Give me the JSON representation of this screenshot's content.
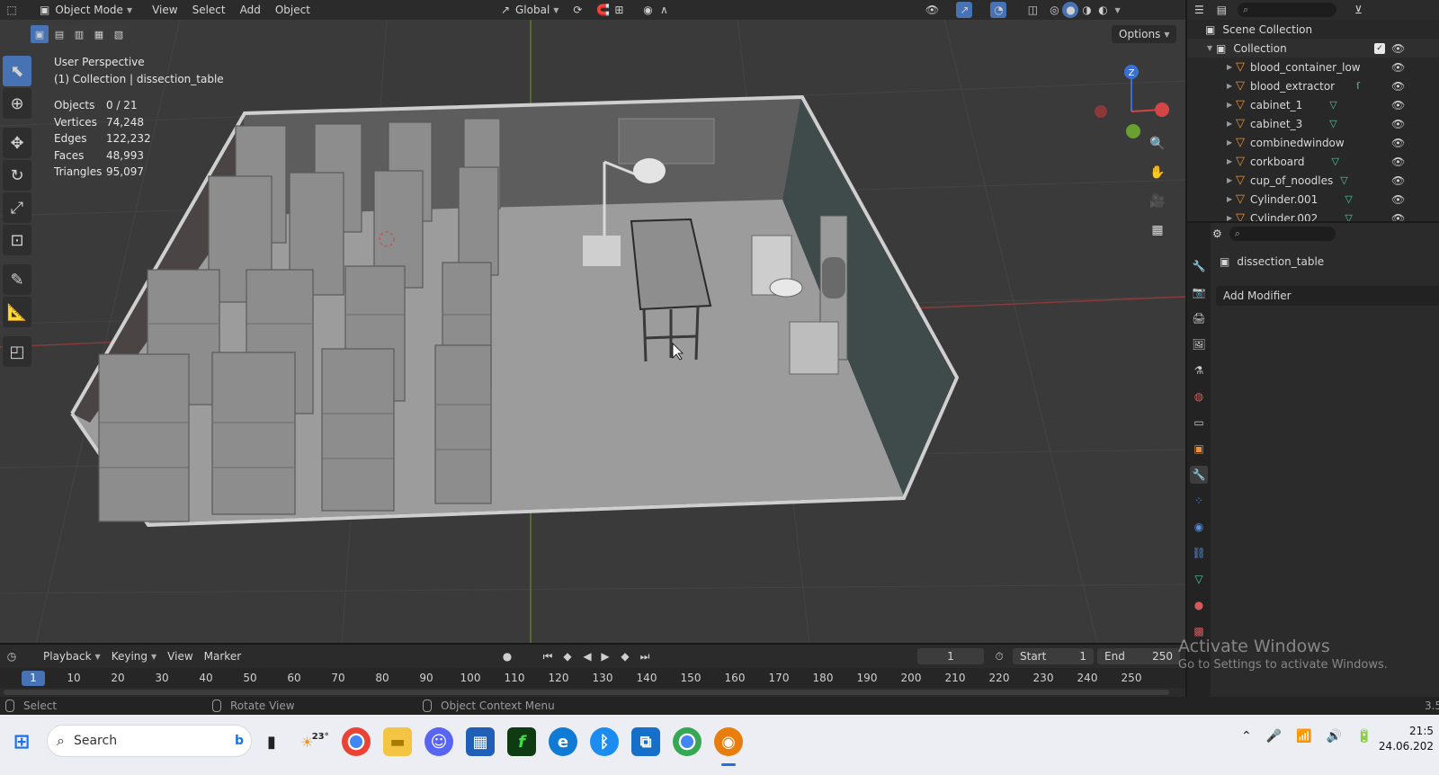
{
  "header": {
    "mode": "Object Mode",
    "menus": [
      "View",
      "Select",
      "Add",
      "Object"
    ],
    "orientation": "Global",
    "options": "Options"
  },
  "viewport": {
    "perspective": "User Perspective",
    "collection_line": "(1) Collection | dissection_table",
    "stats": [
      {
        "label": "Objects",
        "value": "0 / 21"
      },
      {
        "label": "Vertices",
        "value": "74,248"
      },
      {
        "label": "Edges",
        "value": "122,232"
      },
      {
        "label": "Faces",
        "value": "48,993"
      },
      {
        "label": "Triangles",
        "value": "95,097"
      }
    ],
    "gizmo_axis": "Z"
  },
  "outliner": {
    "scene_collection": "Scene Collection",
    "collection": "Collection",
    "items": [
      {
        "name": "blood_container_low"
      },
      {
        "name": "blood_extractor"
      },
      {
        "name": "cabinet_1"
      },
      {
        "name": "cabinet_3"
      },
      {
        "name": "combinedwindow"
      },
      {
        "name": "corkboard"
      },
      {
        "name": "cup_of_noodles"
      },
      {
        "name": "Cylinder.001"
      },
      {
        "name": "Cylinder.002"
      }
    ]
  },
  "properties": {
    "object_name": "dissection_table",
    "add_modifier": "Add Modifier"
  },
  "timeline": {
    "menus": [
      "Playback",
      "Keying",
      "View",
      "Marker"
    ],
    "current_frame": "1",
    "frame_field": "1",
    "start_label": "Start",
    "start_value": "1",
    "end_label": "End",
    "end_value": "250",
    "ticks": [
      "10",
      "20",
      "30",
      "40",
      "50",
      "60",
      "70",
      "80",
      "90",
      "100",
      "110",
      "120",
      "130",
      "140",
      "150",
      "160",
      "170",
      "180",
      "190",
      "200",
      "210",
      "220",
      "230",
      "240",
      "250"
    ]
  },
  "status": {
    "select": "Select",
    "rotate": "Rotate View",
    "context": "Object Context Menu",
    "version": "3.5"
  },
  "watermark": {
    "title": "Activate Windows",
    "subtitle": "Go to Settings to activate Windows."
  },
  "taskbar": {
    "search": "Search",
    "weather": "23°",
    "time": "21:5",
    "date": "24.06.202"
  }
}
